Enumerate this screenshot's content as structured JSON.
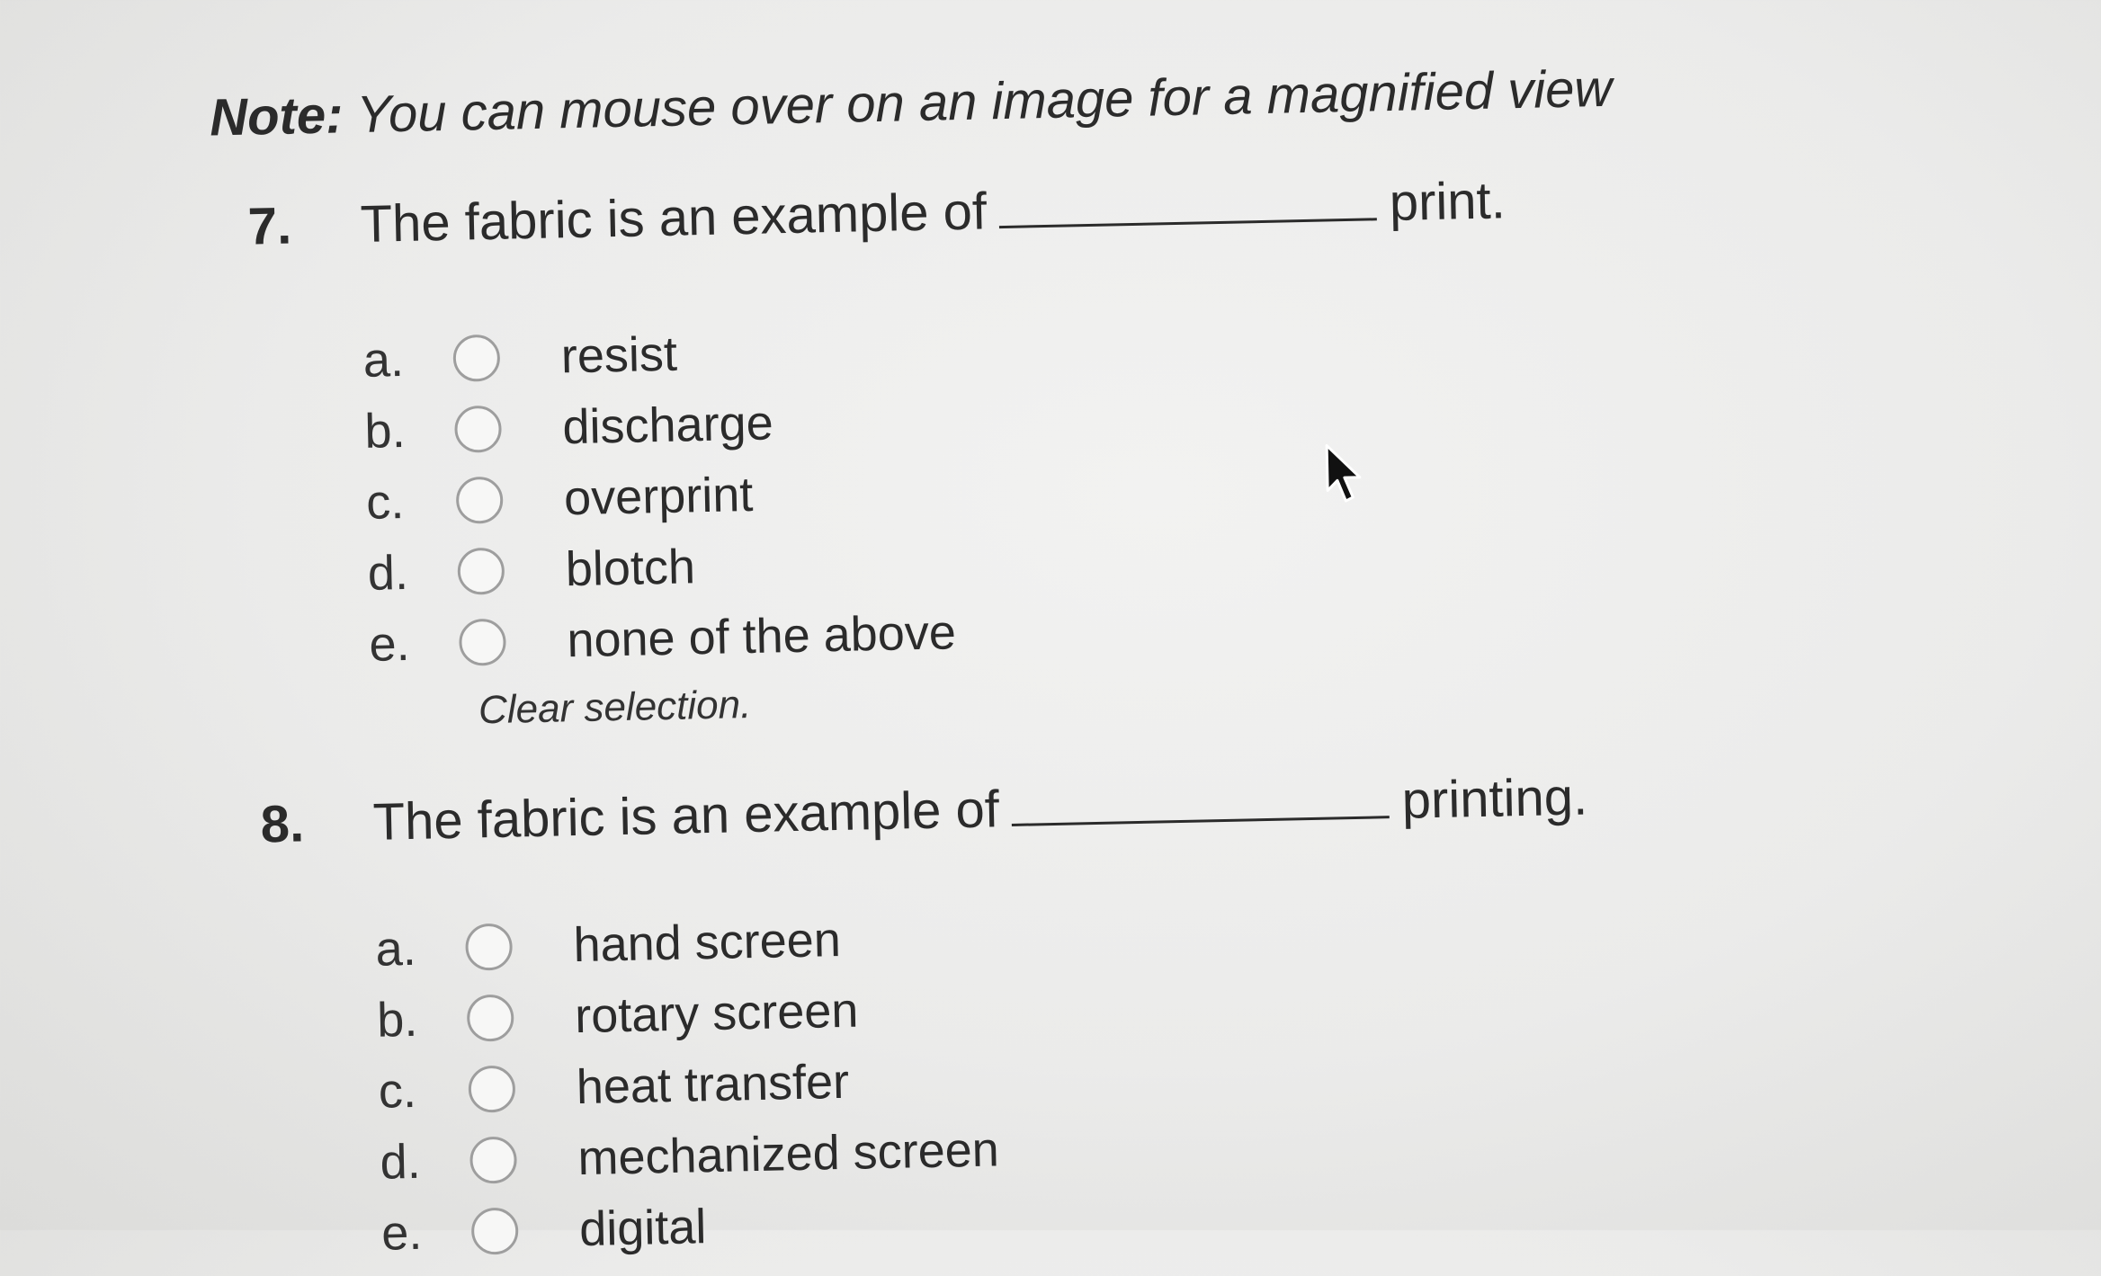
{
  "note": {
    "label": "Note:",
    "text": "You can mouse over on an image for a magnified view"
  },
  "questions": [
    {
      "number": "7.",
      "text_before": "The fabric is an example of",
      "text_after": "print.",
      "options": [
        {
          "letter": "a.",
          "label": "resist"
        },
        {
          "letter": "b.",
          "label": "discharge"
        },
        {
          "letter": "c.",
          "label": "overprint"
        },
        {
          "letter": "d.",
          "label": "blotch"
        },
        {
          "letter": "e.",
          "label": "none of the above"
        }
      ],
      "clear_label": "Clear selection."
    },
    {
      "number": "8.",
      "text_before": "The fabric is an example of",
      "text_after": "printing.",
      "options": [
        {
          "letter": "a.",
          "label": "hand screen"
        },
        {
          "letter": "b.",
          "label": "rotary screen"
        },
        {
          "letter": "c.",
          "label": "heat transfer"
        },
        {
          "letter": "d.",
          "label": "mechanized screen"
        },
        {
          "letter": "e.",
          "label": "digital"
        }
      ]
    }
  ],
  "icons": {
    "cursor": "mouse-pointer-icon",
    "radio": "radio-button-icon"
  }
}
